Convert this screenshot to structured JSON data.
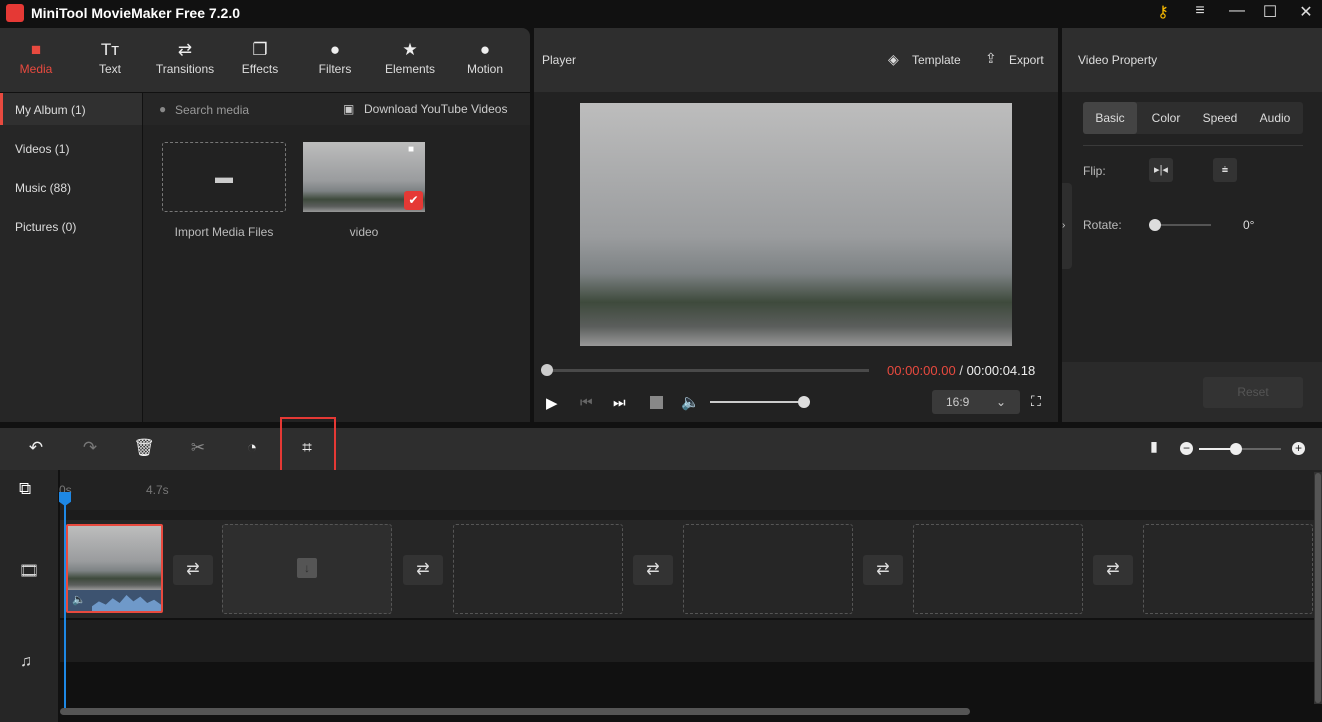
{
  "app": {
    "title": "MiniTool MovieMaker Free 7.2.0",
    "window_controls": [
      "key-icon",
      "menu-icon",
      "minimize-icon",
      "maximize-icon",
      "close-icon"
    ]
  },
  "toolbar": {
    "items": [
      {
        "label": "Media",
        "icon": "folder-icon",
        "active": true
      },
      {
        "label": "Text",
        "icon": "text-icon"
      },
      {
        "label": "Transitions",
        "icon": "transitions-icon"
      },
      {
        "label": "Effects",
        "icon": "effects-icon"
      },
      {
        "label": "Filters",
        "icon": "filters-icon"
      },
      {
        "label": "Elements",
        "icon": "elements-icon"
      },
      {
        "label": "Motion",
        "icon": "motion-icon"
      }
    ]
  },
  "sidebar": {
    "items": [
      {
        "label": "My Album (1)"
      },
      {
        "label": "Videos (1)"
      },
      {
        "label": "Music (88)"
      },
      {
        "label": "Pictures (0)"
      }
    ]
  },
  "media": {
    "search_placeholder": "Search media",
    "download_label": "Download YouTube Videos",
    "import_label": "Import Media Files",
    "video_label": "video"
  },
  "player": {
    "title": "Player",
    "template_label": "Template",
    "export_label": "Export",
    "current_time": "00:00:00.00",
    "separator": "/",
    "total_time": "00:00:04.18",
    "aspect_ratio": "16:9",
    "progress": 0,
    "volume": 1.0
  },
  "property": {
    "title": "Video Property",
    "tabs": [
      "Basic",
      "Color",
      "Speed",
      "Audio"
    ],
    "active_tab": "Basic",
    "flip_label": "Flip:",
    "rotate_label": "Rotate:",
    "rotate_value": "0°",
    "reset_label": "Reset"
  },
  "timeline": {
    "ruler": [
      "0s",
      "4.7s"
    ],
    "zoom_level": 0.5
  },
  "colors": {
    "accent": "#e84a3f",
    "playhead": "#1e88e5"
  }
}
